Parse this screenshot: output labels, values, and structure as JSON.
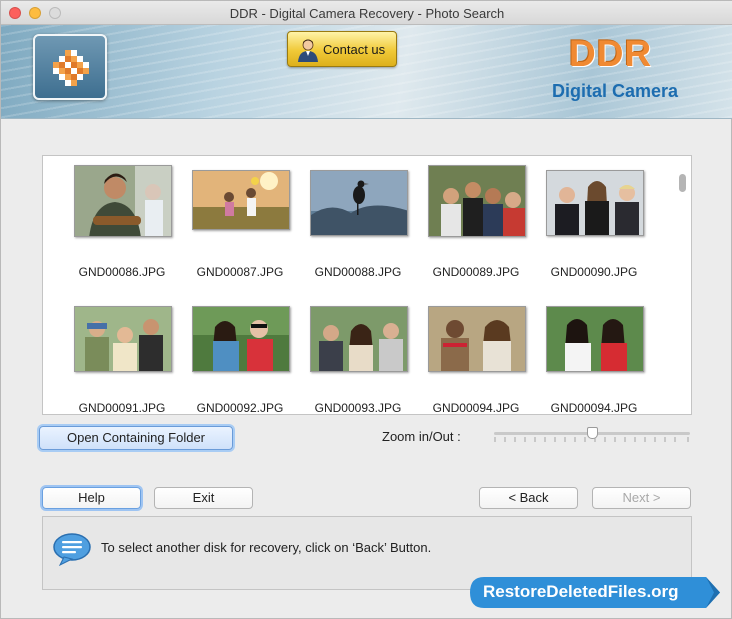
{
  "window": {
    "title": "DDR - Digital Camera Recovery - Photo Search"
  },
  "header": {
    "contact_label": "Contact us",
    "brand_title": "DDR",
    "brand_subtitle": "Digital Camera",
    "brand_title_color": "#f08a33",
    "brand_subtitle_color": "#1d6db0"
  },
  "thumbnails": [
    {
      "name": "GND00086.JPG",
      "scene": "guitar-man"
    },
    {
      "name": "GND00087.JPG",
      "scene": "kids-field"
    },
    {
      "name": "GND00088.JPG",
      "scene": "bird-lake"
    },
    {
      "name": "GND00089.JPG",
      "scene": "group-friends"
    },
    {
      "name": "GND00090.JPG",
      "scene": "three-portrait"
    },
    {
      "name": "GND00091.JPG",
      "scene": "friends-outdoor"
    },
    {
      "name": "GND00092.JPG",
      "scene": "two-women-park"
    },
    {
      "name": "GND00093.JPG",
      "scene": "three-smiling"
    },
    {
      "name": "GND00094.JPG",
      "scene": "couple-laughing"
    },
    {
      "name": "GND00094.JPG",
      "scene": "two-girls"
    }
  ],
  "actions": {
    "open_folder_label": "Open Containing Folder",
    "zoom_label": "Zoom in/Out :",
    "zoom_level": 0.5
  },
  "nav": {
    "help_label": "Help",
    "exit_label": "Exit",
    "back_label": "< Back",
    "next_label": "Next >"
  },
  "message": {
    "text": "To select another disk for recovery, click on ‘Back’ Button."
  },
  "watermark": {
    "text": "RestoreDeletedFiles.org",
    "color": "#2f8fd8"
  }
}
